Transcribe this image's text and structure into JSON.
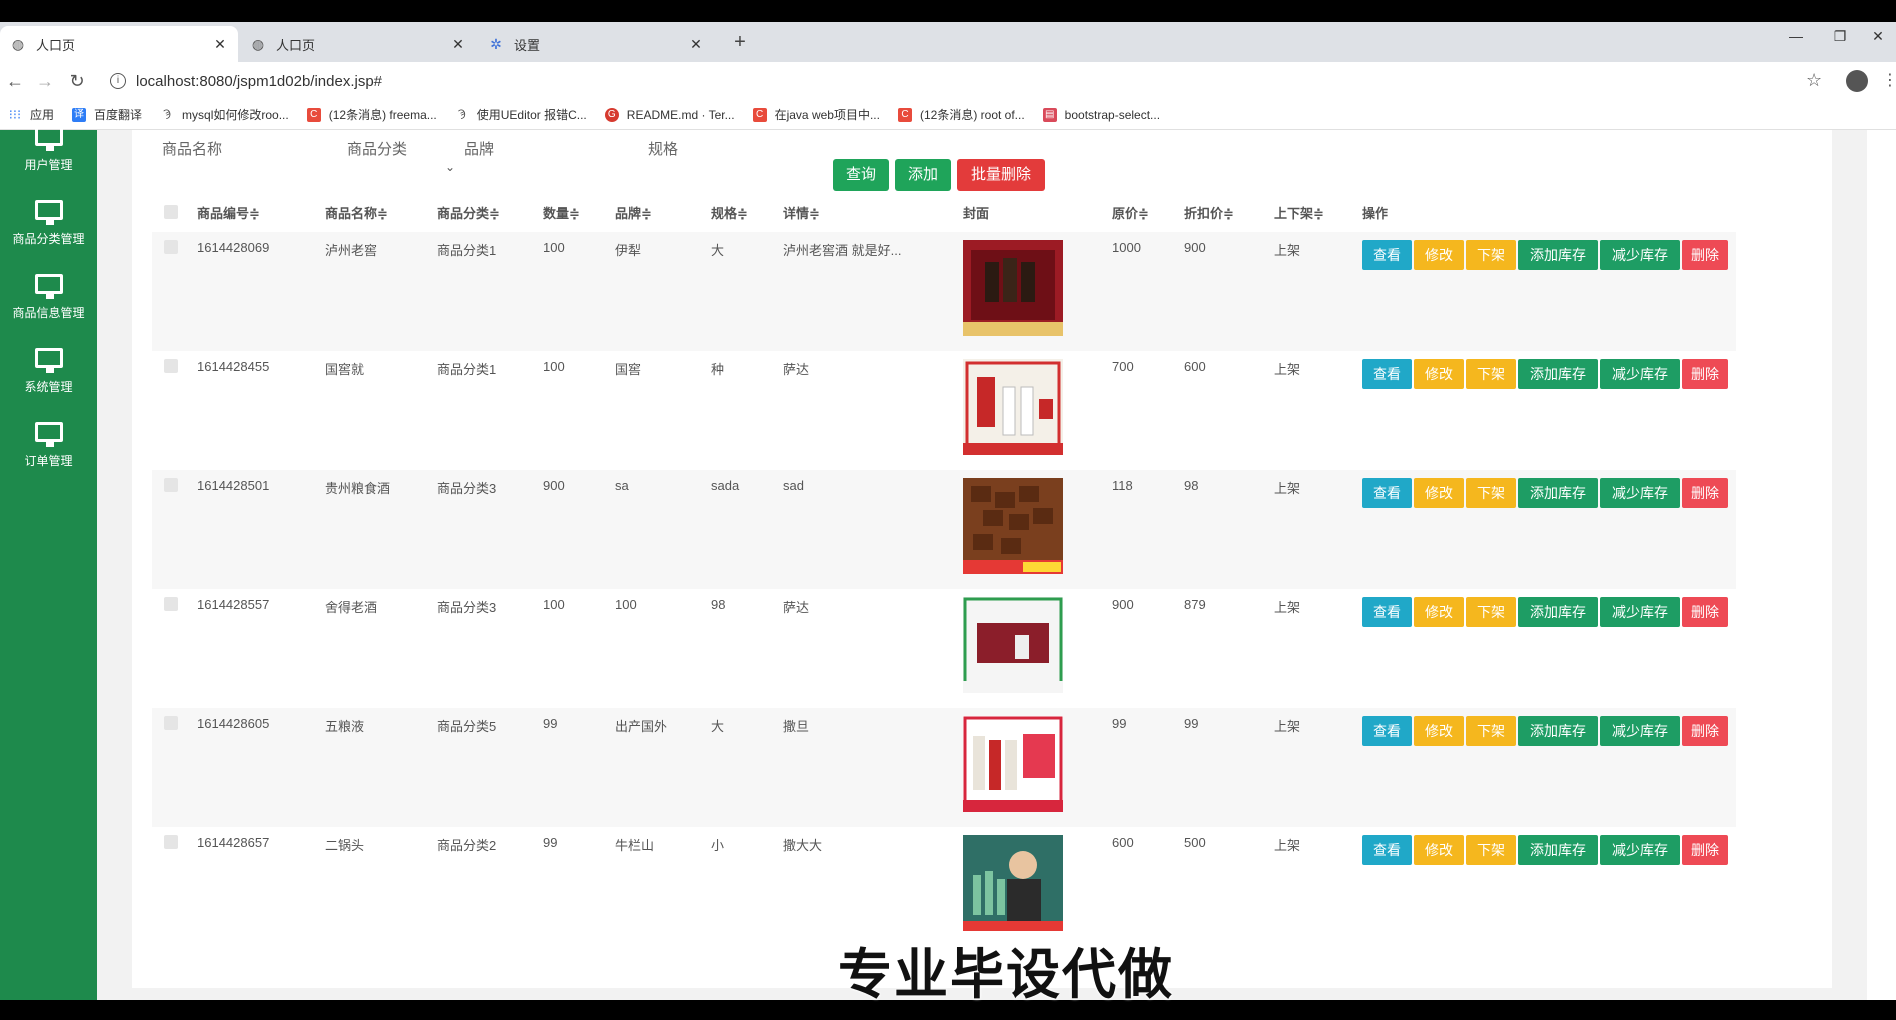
{
  "tabs": [
    {
      "label": "人口页",
      "icon": "globe-icon"
    },
    {
      "label": "人口页",
      "icon": "globe-icon"
    },
    {
      "label": "设置",
      "icon": "gear-icon"
    }
  ],
  "address": {
    "url": "localhost:8080/jspm1d02b/index.jsp#"
  },
  "bookmarks": [
    {
      "label": "应用",
      "color": "#4285f4"
    },
    {
      "label": "百度翻译",
      "color": "#2e7df6"
    },
    {
      "label": "mysql如何修改roo...",
      "color": "#444444"
    },
    {
      "label": "(12条消息) freema...",
      "color": "#e84b3c"
    },
    {
      "label": "使用UEditor 报错C...",
      "color": "#444444"
    },
    {
      "label": "README.md · Ter...",
      "color": "#d63a2f"
    },
    {
      "label": "在java web项目中...",
      "color": "#e84b3c"
    },
    {
      "label": "(12条消息) root of...",
      "color": "#e84b3c"
    },
    {
      "label": "bootstrap-select...",
      "color": "#d94a5a"
    }
  ],
  "sidebar": [
    {
      "label": "用户管理"
    },
    {
      "label": "商品分类管理"
    },
    {
      "label": "商品信息管理"
    },
    {
      "label": "系统管理"
    },
    {
      "label": "订单管理"
    }
  ],
  "search": {
    "name_label": "商品名称",
    "category_label": "商品分类",
    "brand_label": "品牌",
    "spec_label": "规格"
  },
  "actions": {
    "query": "查询",
    "add": "添加",
    "batch_delete": "批量删除"
  },
  "columns": [
    "商品编号≑",
    "商品名称≑",
    "商品分类≑",
    "数量≑",
    "品牌≑",
    "规格≑",
    "详情≑",
    "封面",
    "原价≑",
    "折扣价≑",
    "上下架≑",
    "操作"
  ],
  "row_buttons": {
    "view": "查看",
    "edit": "修改",
    "offshelf": "下架",
    "add_stock": "添加库存",
    "reduce_stock": "减少库存",
    "delete": "删除"
  },
  "rows": [
    {
      "id": "1614428069",
      "name": "泸州老窖",
      "category": "商品分类1",
      "qty": "100",
      "brand": "伊犁",
      "spec": "大",
      "detail": "泸州老窖酒 就是好...",
      "price": "1000",
      "discount": "900",
      "status": "上架",
      "cover": "wine-box-red"
    },
    {
      "id": "1614428455",
      "name": "国窖就",
      "category": "商品分类1",
      "qty": "100",
      "brand": "国窖",
      "spec": "种",
      "detail": "萨达",
      "price": "700",
      "discount": "600",
      "status": "上架",
      "cover": "bottles-white-red"
    },
    {
      "id": "1614428501",
      "name": "贵州粮食酒",
      "category": "商品分类3",
      "qty": "900",
      "brand": "sa",
      "spec": "sada",
      "detail": "sad",
      "price": "118",
      "discount": "98",
      "status": "上架",
      "cover": "chocolate-brown"
    },
    {
      "id": "1614428557",
      "name": "舍得老酒",
      "category": "商品分类3",
      "qty": "100",
      "brand": "100",
      "spec": "98",
      "detail": "萨达",
      "price": "900",
      "discount": "879",
      "status": "上架",
      "cover": "gift-box-green"
    },
    {
      "id": "1614428605",
      "name": "五粮液",
      "category": "商品分类5",
      "qty": "99",
      "brand": "出产国外",
      "spec": "大",
      "detail": "撒旦",
      "price": "99",
      "discount": "99",
      "status": "上架",
      "cover": "bottles-red-frame"
    },
    {
      "id": "1614428657",
      "name": "二锅头",
      "category": "商品分类2",
      "qty": "99",
      "brand": "牛栏山",
      "spec": "小",
      "detail": "撒大大",
      "price": "600",
      "discount": "500",
      "status": "上架",
      "cover": "man-with-bottles"
    }
  ],
  "watermark": "专业毕设代做",
  "colors": {
    "sidebar": "#1e8a4c",
    "query": "#1fa45a",
    "batch_delete": "#e33b3b"
  }
}
